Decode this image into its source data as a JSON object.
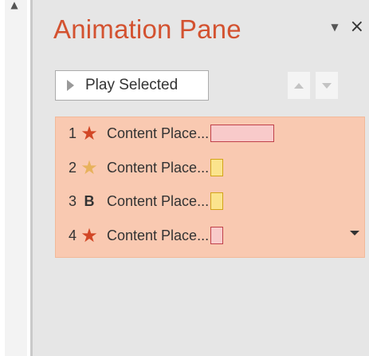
{
  "pane": {
    "title": "Animation Pane",
    "play_button_label": "Play Selected",
    "colors": {
      "title": "#d35230",
      "list_bg": "#f9c9b1",
      "emphasis_star": "#d24726",
      "entrance_star": "#e8b25c"
    }
  },
  "animations": [
    {
      "number": "1",
      "effect_glyph": "★",
      "effect_icon": "star-red-icon",
      "name": "Content Place..."
    },
    {
      "number": "2",
      "effect_glyph": "★",
      "effect_icon": "star-gold-icon",
      "name": "Content Place..."
    },
    {
      "number": "3",
      "effect_glyph": "B",
      "effect_icon": "bold-b-icon",
      "name": "Content Place..."
    },
    {
      "number": "4",
      "effect_glyph": "★",
      "effect_icon": "star-red-icon",
      "name": "Content Place..."
    }
  ]
}
